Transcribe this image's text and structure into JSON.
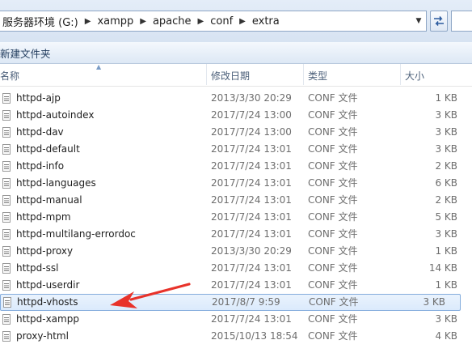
{
  "address_bar": {
    "crumbs": [
      "服务器环境 (G:)",
      "xampp",
      "apache",
      "conf",
      "extra"
    ]
  },
  "toolbar": {
    "new_folder_label": "新建文件夹"
  },
  "columns": {
    "name": "名称",
    "date": "修改日期",
    "type": "类型",
    "size": "大小"
  },
  "files": [
    {
      "name": "httpd-ajp",
      "date": "2013/3/30 20:29",
      "type": "CONF 文件",
      "size": "1 KB"
    },
    {
      "name": "httpd-autoindex",
      "date": "2017/7/24 13:00",
      "type": "CONF 文件",
      "size": "3 KB"
    },
    {
      "name": "httpd-dav",
      "date": "2017/7/24 13:00",
      "type": "CONF 文件",
      "size": "3 KB"
    },
    {
      "name": "httpd-default",
      "date": "2017/7/24 13:01",
      "type": "CONF 文件",
      "size": "3 KB"
    },
    {
      "name": "httpd-info",
      "date": "2017/7/24 13:01",
      "type": "CONF 文件",
      "size": "2 KB"
    },
    {
      "name": "httpd-languages",
      "date": "2017/7/24 13:01",
      "type": "CONF 文件",
      "size": "6 KB"
    },
    {
      "name": "httpd-manual",
      "date": "2017/7/24 13:01",
      "type": "CONF 文件",
      "size": "2 KB"
    },
    {
      "name": "httpd-mpm",
      "date": "2017/7/24 13:01",
      "type": "CONF 文件",
      "size": "5 KB"
    },
    {
      "name": "httpd-multilang-errordoc",
      "date": "2017/7/24 13:01",
      "type": "CONF 文件",
      "size": "3 KB"
    },
    {
      "name": "httpd-proxy",
      "date": "2013/3/30 20:29",
      "type": "CONF 文件",
      "size": "1 KB"
    },
    {
      "name": "httpd-ssl",
      "date": "2017/7/24 13:01",
      "type": "CONF 文件",
      "size": "14 KB"
    },
    {
      "name": "httpd-userdir",
      "date": "2017/7/24 13:01",
      "type": "CONF 文件",
      "size": "1 KB"
    },
    {
      "name": "httpd-vhosts",
      "date": "2017/8/7 9:59",
      "type": "CONF 文件",
      "size": "3 KB"
    },
    {
      "name": "httpd-xampp",
      "date": "2017/7/24 13:01",
      "type": "CONF 文件",
      "size": "3 KB"
    },
    {
      "name": "proxy-html",
      "date": "2015/10/13 18:54",
      "type": "CONF 文件",
      "size": "4 KB"
    }
  ],
  "selected_index": 12,
  "icons": [
    "chevron-right-icon",
    "chevron-down-icon",
    "refresh-icon",
    "conf-file-icon",
    "red-arrow-annotation"
  ],
  "colors": {
    "selection": "#dbeafc",
    "selection_border": "#84acdd",
    "annotation": "#e8322a"
  }
}
